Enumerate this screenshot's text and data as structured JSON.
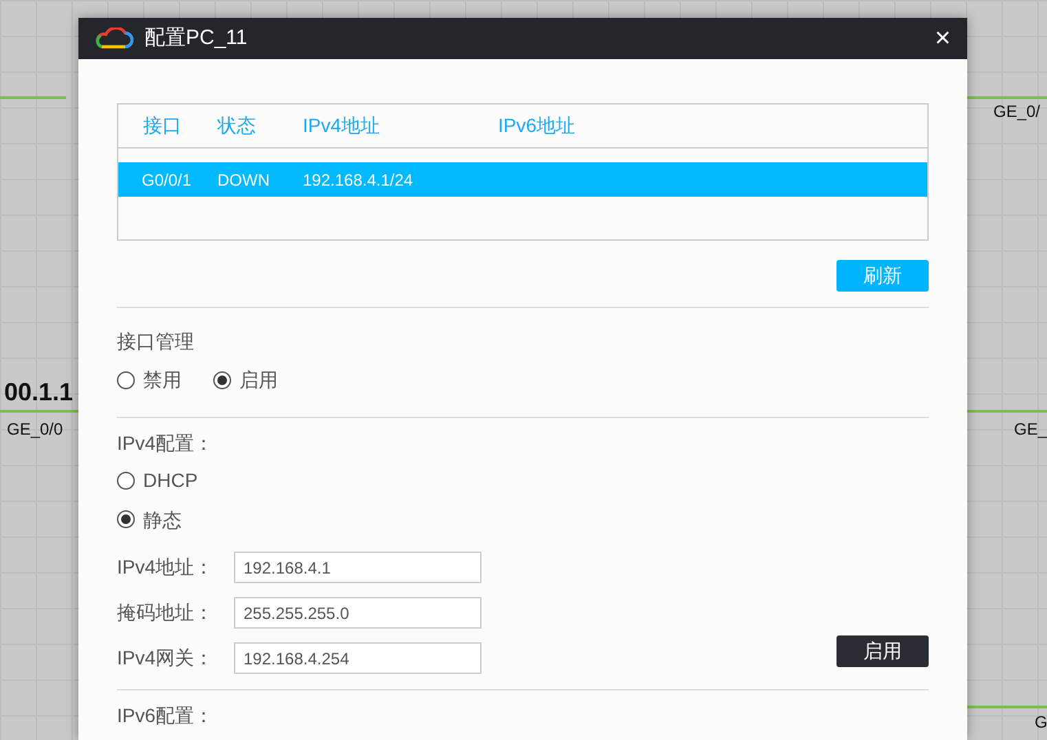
{
  "canvas_labels": [
    {
      "text": "GE_0/",
      "kind": "port"
    },
    {
      "text": "00.1.1",
      "kind": "address"
    },
    {
      "text": "GE_0/0",
      "kind": "port"
    },
    {
      "text": "GE_",
      "kind": "port"
    },
    {
      "text": "G",
      "kind": "port"
    }
  ],
  "window": {
    "title": "配置PC_11",
    "close": "×"
  },
  "interfaces": {
    "columns": [
      "接口",
      "状态",
      "IPv4地址",
      "IPv6地址"
    ],
    "rows": [
      {
        "cells": [
          "G0/0/1",
          "DOWN",
          "192.168.4.1/24",
          ""
        ],
        "selected": true
      }
    ]
  },
  "refresh_button": "刷新",
  "interface_management": {
    "label": "接口管理",
    "options": [
      {
        "label": "禁用",
        "selected": false
      },
      {
        "label": "启用",
        "selected": true
      }
    ]
  },
  "ipv4": {
    "label": "IPv4配置：",
    "options": [
      {
        "label": "DHCP",
        "selected": false
      },
      {
        "label": "静态",
        "selected": true
      }
    ],
    "fields": [
      {
        "label": "IPv4地址：",
        "value": "192.168.4.1"
      },
      {
        "label": "掩码地址：",
        "value": "255.255.255.0"
      },
      {
        "label": "IPv4网关：",
        "value": "192.168.4.254"
      }
    ],
    "apply_button": "启用"
  },
  "ipv6": {
    "label": "IPv6配置："
  }
}
